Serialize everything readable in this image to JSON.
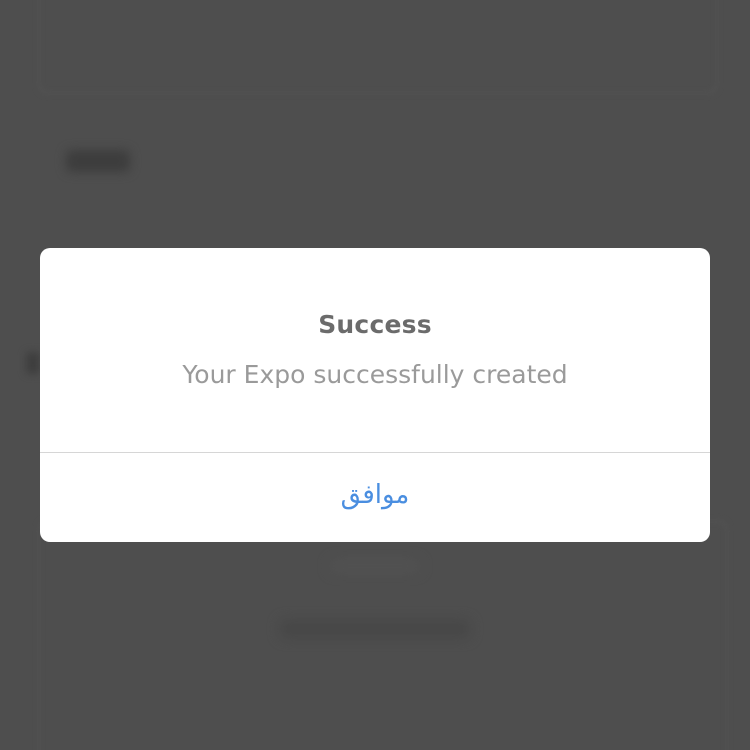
{
  "alert": {
    "title": "Success",
    "message": "Your Expo successfully created",
    "ok_button_label": "موافق"
  },
  "colors": {
    "overlay": "#4e4e4e",
    "dialog_background": "#ffffff",
    "title": "#6b6b6b",
    "message": "#9a9a9a",
    "button_text": "#4a8ee0",
    "divider": "#d6d6d6"
  }
}
